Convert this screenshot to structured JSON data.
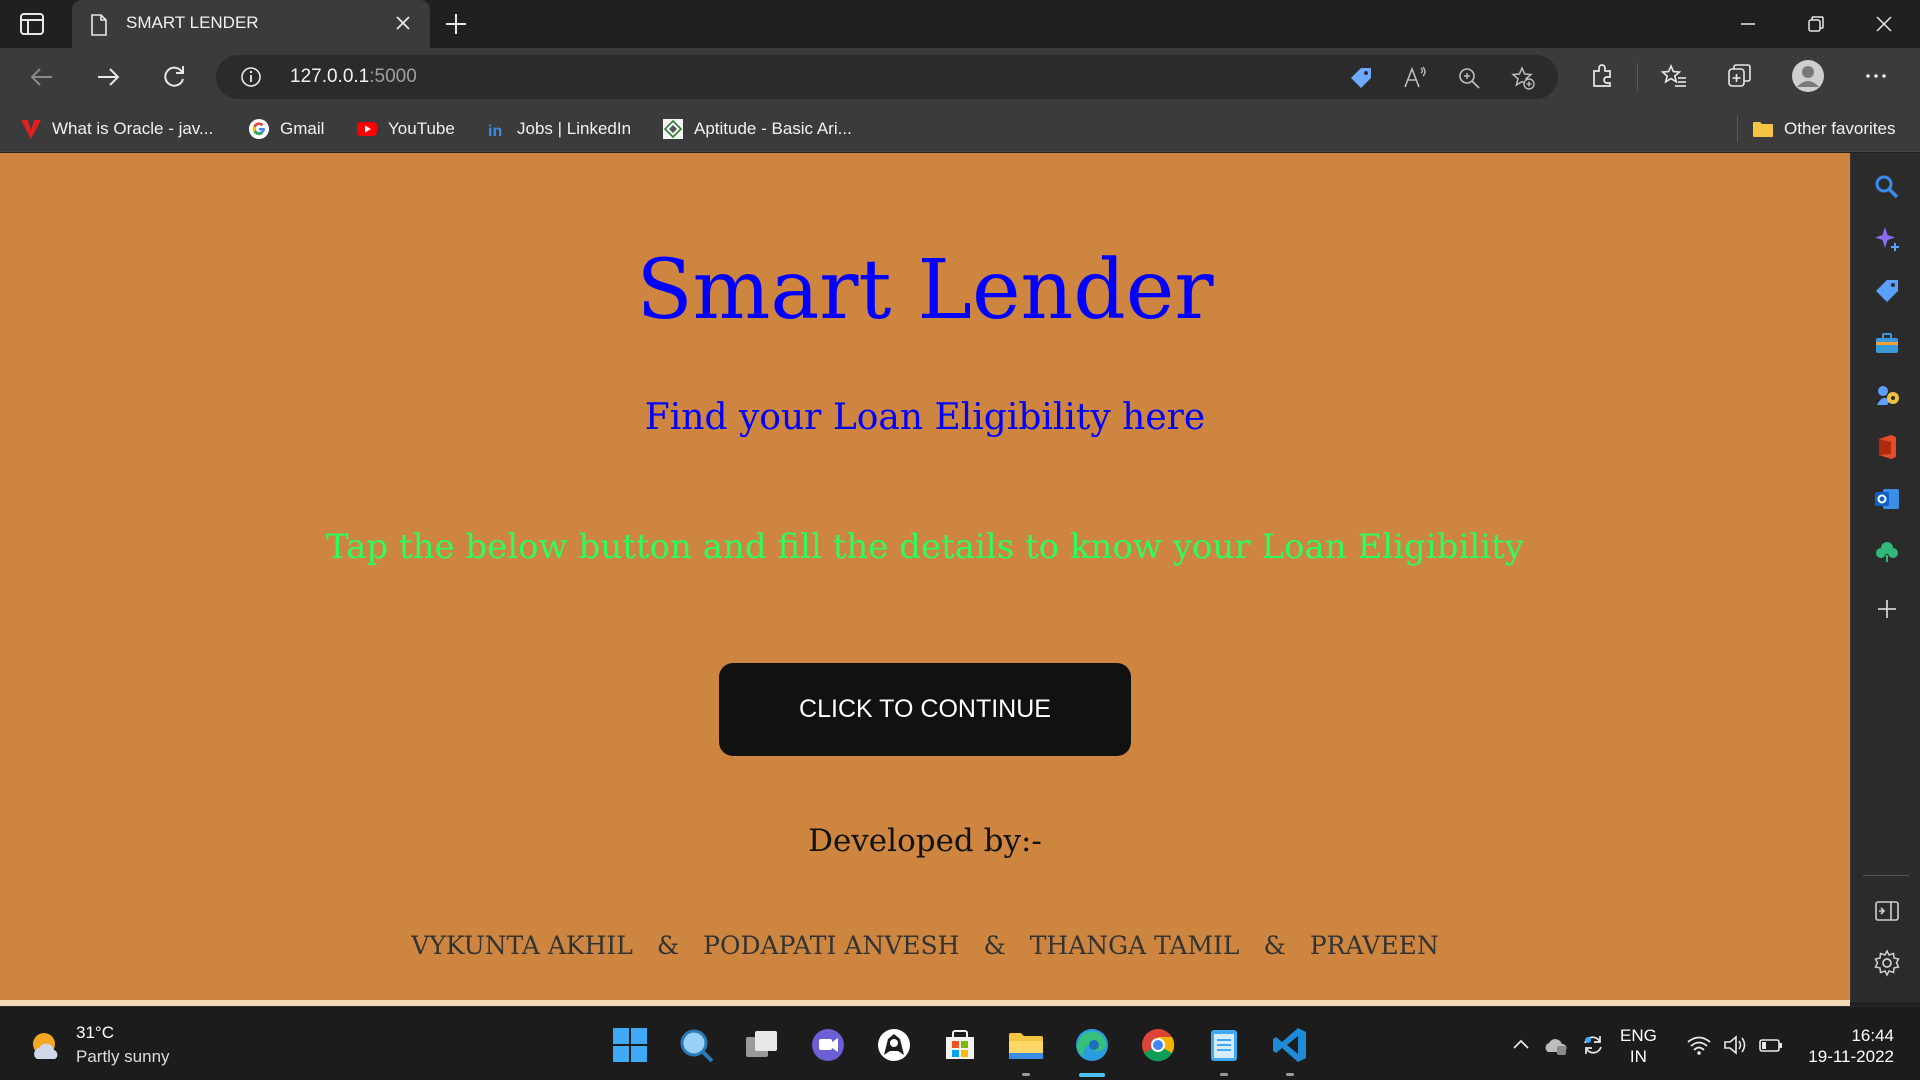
{
  "browser": {
    "tab_title": "SMART LENDER",
    "url_host": "127.0.0.1",
    "url_port": ":5000",
    "bookmarks": [
      {
        "label": "What is Oracle - jav...",
        "icon": "oracle-v-icon"
      },
      {
        "label": "Gmail",
        "icon": "google-icon"
      },
      {
        "label": "YouTube",
        "icon": "youtube-icon"
      },
      {
        "label": "Jobs | LinkedIn",
        "icon": "linkedin-icon"
      },
      {
        "label": "Aptitude - Basic Ari...",
        "icon": "aptitude-site-icon"
      }
    ],
    "other_favorites": "Other favorites"
  },
  "page": {
    "heading": "Smart Lender",
    "subheading": "Find your Loan Eligibility here",
    "instruction": "Tap the below button and fill the details to know your Loan Eligibility",
    "button_label": "CLICK TO CONTINUE",
    "developed_by": "Developed by:-",
    "developers": [
      "VYKUNTA AKHIL",
      "PODAPATI ANVESH",
      "THANGA TAMIL",
      "PRAVEEN"
    ],
    "separator": "&"
  },
  "taskbar": {
    "weather_temp": "31°C",
    "weather_desc": "Partly sunny",
    "lang_line1": "ENG",
    "lang_line2": "IN",
    "time": "16:44",
    "date": "19-11-2022"
  },
  "colors": {
    "page_bg": "#cd853f",
    "heading": "#0000ff",
    "instruction": "#2cff5c",
    "button_bg": "#111111"
  }
}
